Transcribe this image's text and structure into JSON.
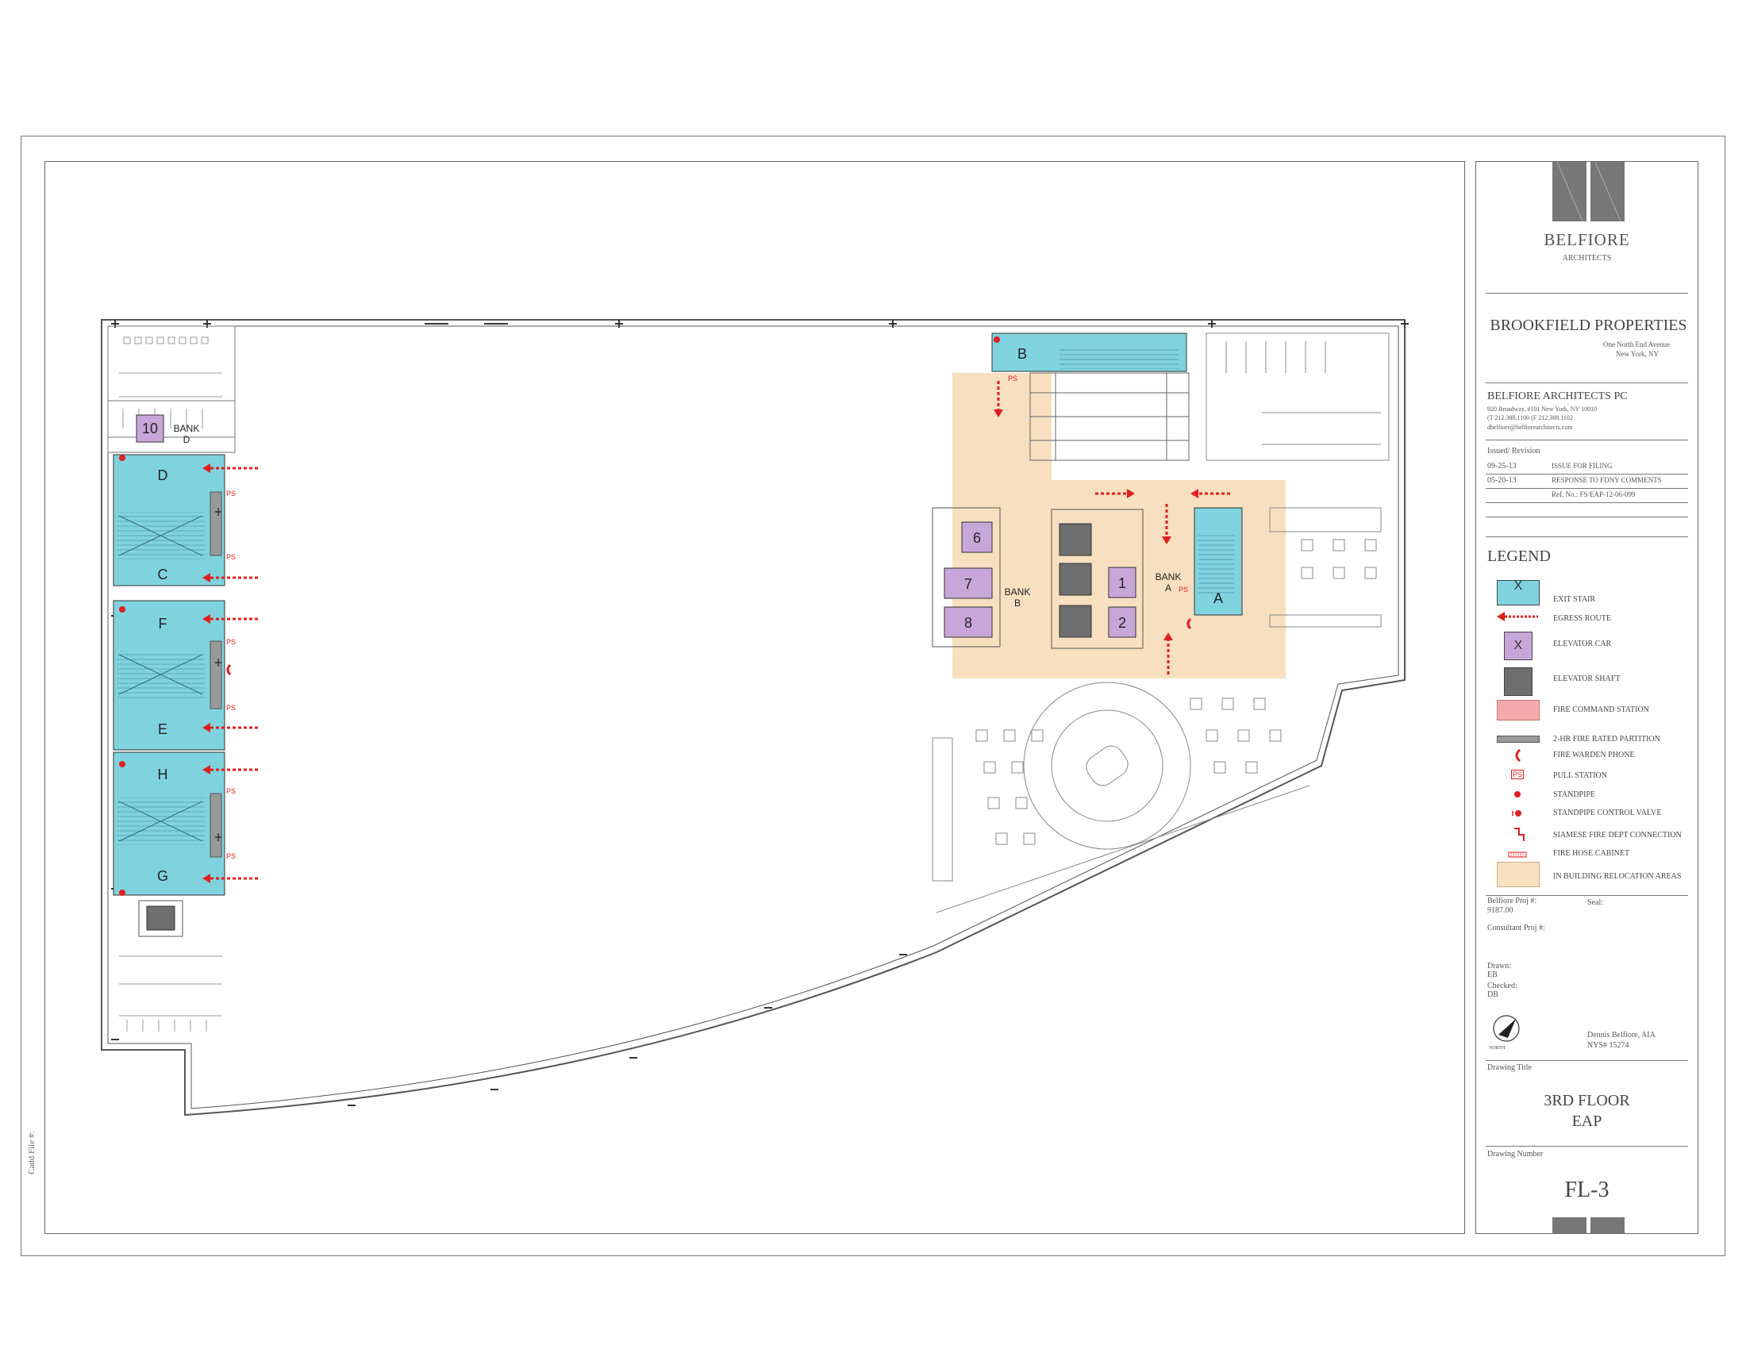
{
  "side_text": "Cadd File #:",
  "title_block": {
    "firm_name": "BELFIORE",
    "firm_subtitle": "ARCHITECTS",
    "client": "BROOKFIELD PROPERTIES",
    "client_address": [
      "One North End Avenue",
      "New York, NY"
    ],
    "architect": {
      "name": "BELFIORE ARCHITECTS PC",
      "line1": "920 Broadway, #101   New York, NY 10010",
      "line2": "(T  212.388.1100   (F  212.388.1102",
      "line3": "dbelfiore@belfiorearchitects.com"
    },
    "issued_label": "Issued/ Revision",
    "revisions": [
      {
        "date": "09-25-13",
        "desc": "ISSUE FOR FILING"
      },
      {
        "date": "05-20-13",
        "desc": "RESPONSE TO FDNY COMMENTS"
      }
    ],
    "ref_no": "Ref. No.: FS/EAP-12-06-099",
    "legend_title": "LEGEND",
    "legend": [
      {
        "icon": "exit-stair",
        "label": "EXIT STAIR",
        "symbol_text": "X",
        "color": "#7fd3de"
      },
      {
        "icon": "egress-arrow",
        "label": "EGRESS ROUTE",
        "color": "#e02020"
      },
      {
        "icon": "elevator-car",
        "label": "ELEVATOR CAR",
        "symbol_text": "X",
        "color": "#c9a6d9"
      },
      {
        "icon": "elevator-shaft",
        "label": "ELEVATOR SHAFT",
        "color": "#707070"
      },
      {
        "icon": "fire-command-station",
        "label": "FIRE COMMAND STATION",
        "color": "#f4aaaa"
      },
      {
        "icon": "fire-rated-partition",
        "label": "2-HR FIRE RATED PARTITION",
        "color": "#999999"
      },
      {
        "icon": "fire-warden-phone",
        "label": "FIRE WARDEN PHONE",
        "color": "#e02020"
      },
      {
        "icon": "pull-station",
        "label": "PULL STATION",
        "symbol_text": "PS",
        "color": "#e02020"
      },
      {
        "icon": "standpipe",
        "label": "STANDPIPE",
        "color": "#e02020"
      },
      {
        "icon": "standpipe-control-valve",
        "label": "STANDPIPE CONTROL VALVE",
        "color": "#e02020"
      },
      {
        "icon": "siamese-connection",
        "label": "SIAMESE FIRE DEPT CONNECTION",
        "color": "#e02020"
      },
      {
        "icon": "fire-hose-cabinet",
        "label": "FIRE HOSE CABINET",
        "color": "#e02020"
      },
      {
        "icon": "relocation-area",
        "label": "IN BUILDING RELOCATION AREAS",
        "color": "#f7dfc0"
      }
    ],
    "belfiore_proj_label": "Belfiore Proj #:",
    "belfiore_proj_value": "9187.00",
    "seal_label": "Seal:",
    "consultant_proj_label": "Consultant Proj #:",
    "drawn_label": "Drawn:",
    "drawn_value": "EB",
    "checked_label": "Checked:",
    "checked_value": "DB",
    "north_label": "NORTH",
    "signer": "Dennis Belfiore, AIA",
    "license": "NYS# 15274",
    "drawing_title_label": "Drawing Title",
    "drawing_title_1": "3RD FLOOR",
    "drawing_title_2": "EAP",
    "drawing_number_label": "Drawing Number",
    "drawing_number": "FL-3"
  },
  "plan": {
    "colors": {
      "stair": "#7fd3de",
      "relocation": "#f7dfc0",
      "car": "#c9a6d9",
      "shaft": "#6e6e6e",
      "egress": "#e02020"
    },
    "west_core": {
      "bank_label_1": "BANK",
      "bank_label_2": "D",
      "car": "10",
      "stairs": [
        "D",
        "C",
        "F",
        "E",
        "H",
        "G"
      ]
    },
    "east_core": {
      "stair_b": "B",
      "stair_a": "A",
      "bank_a_1": "BANK",
      "bank_a_2": "A",
      "bank_b_1": "BANK",
      "bank_b_2": "B",
      "cars": [
        "6",
        "7",
        "8",
        "1",
        "2"
      ]
    },
    "pull_station_text": "PS"
  }
}
